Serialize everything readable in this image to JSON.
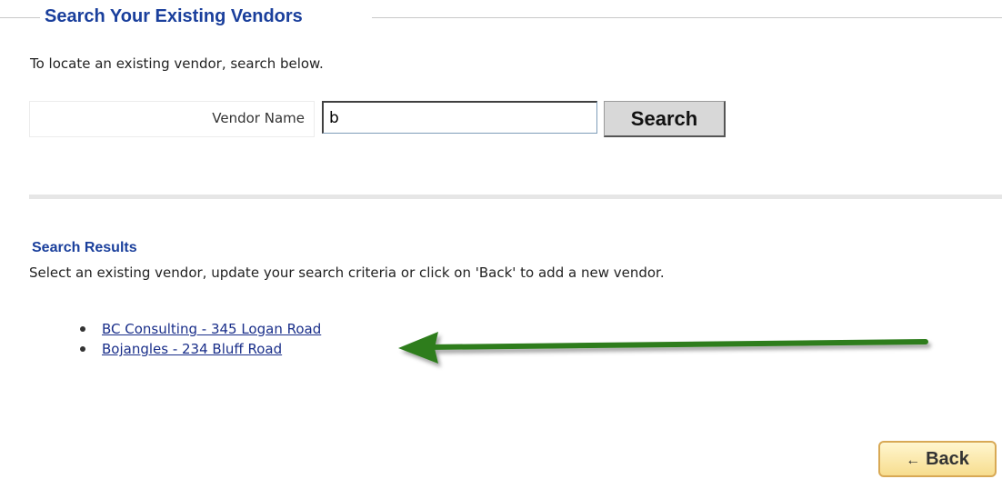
{
  "section": {
    "title": "Search Your Existing Vendors",
    "intro": "To locate an existing vendor, search below."
  },
  "search": {
    "label": "Vendor Name",
    "value": "b",
    "button_label": "Search"
  },
  "results": {
    "title": "Search Results",
    "description": "Select an existing vendor, update your search criteria or click on 'Back' to add a new vendor.",
    "items": [
      {
        "label": "BC Consulting - 345 Logan Road"
      },
      {
        "label": "Bojangles - 234 Bluff Road"
      }
    ]
  },
  "annotation": {
    "arrow_color": "#2e7d1f",
    "icon": "arrow-left-icon"
  },
  "footer": {
    "back_label": "Back",
    "back_icon": "arrow-left-icon"
  },
  "colors": {
    "heading": "#1a3f9c",
    "link": "#1a2f8a",
    "back_button": "#f7dd8e"
  }
}
